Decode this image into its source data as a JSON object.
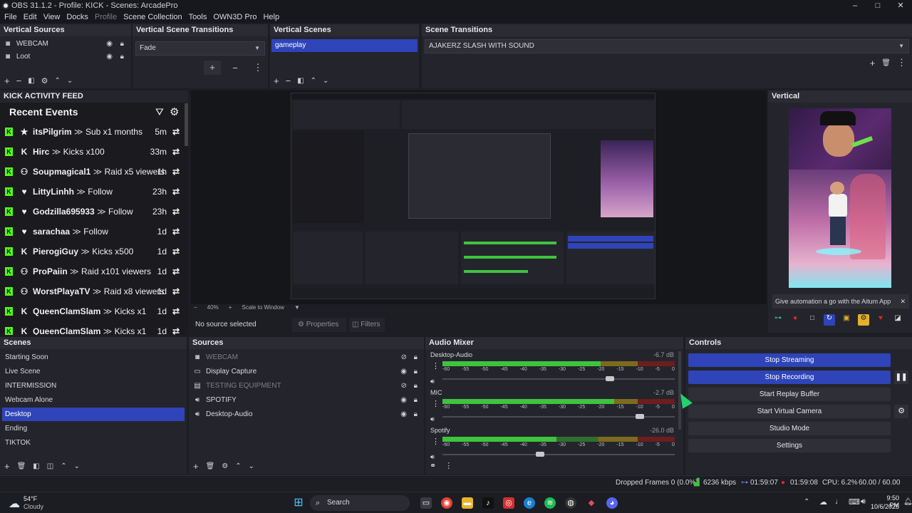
{
  "window": {
    "title": "OBS 31.1.2 - Profile: KICK - Scenes: ArcadePro",
    "minimize": "–",
    "maximize": "□",
    "close": "✕"
  },
  "menu": [
    "File",
    "Edit",
    "View",
    "Docks",
    "Profile",
    "Scene Collection",
    "Tools",
    "OWN3D Pro",
    "Help"
  ],
  "vertical_sources": {
    "title": "Vertical Sources",
    "items": [
      "WEBCAM",
      "Loot"
    ]
  },
  "vertical_scene_transitions": {
    "title": "Vertical Scene Transitions",
    "selected": "Fade"
  },
  "vertical_scenes": {
    "title": "Vertical Scenes",
    "items": [
      "gameplay"
    ]
  },
  "scene_transitions": {
    "title": "Scene Transitions",
    "selected": "AJAKERZ SLASH WITH SOUND"
  },
  "kick_feed": {
    "title": "KICK ACTIVITY FEED",
    "heading": "Recent Events",
    "events": [
      {
        "icon": "★",
        "user": "itsPilgrim",
        "action": "Sub x1 months",
        "time": "5m"
      },
      {
        "icon": "K",
        "user": "Hirc",
        "action": "Kicks x100",
        "time": "33m"
      },
      {
        "icon": "⚇",
        "user": "Soupmagical1",
        "action": "Raid x5 viewers",
        "time": "1h"
      },
      {
        "icon": "♥",
        "user": "LittyLinhh",
        "action": "Follow",
        "time": "23h"
      },
      {
        "icon": "♥",
        "user": "Godzilla695933",
        "action": "Follow",
        "time": "23h"
      },
      {
        "icon": "♥",
        "user": "sarachaa",
        "action": "Follow",
        "time": "1d"
      },
      {
        "icon": "K",
        "user": "PierogiGuy",
        "action": "Kicks x500",
        "time": "1d"
      },
      {
        "icon": "⚇",
        "user": "ProPaiin",
        "action": "Raid x101 viewers",
        "time": "1d"
      },
      {
        "icon": "⚇",
        "user": "WorstPlayaTV",
        "action": "Raid x8 viewers",
        "time": "1d"
      },
      {
        "icon": "K",
        "user": "QueenClamSlam",
        "action": "Kicks x1",
        "time": "1d"
      },
      {
        "icon": "K",
        "user": "QueenClamSlam",
        "action": "Kicks x1",
        "time": "1d"
      }
    ]
  },
  "preview": {
    "zoom": "40%",
    "scale_mode": "Scale to Window"
  },
  "source_bar": {
    "status": "No source selected",
    "properties": "Properties",
    "filters": "Filters"
  },
  "vertical": {
    "title": "Vertical",
    "banner": "Give automation a go with the Aitum App"
  },
  "scenes": {
    "title": "Scenes",
    "items": [
      "Starting Soon",
      "Live Scene",
      "INTERMISSION",
      "Webcam Alone",
      "Desktop",
      "Ending",
      "TIKTOK"
    ],
    "selected_index": 4
  },
  "sources": {
    "title": "Sources",
    "items": [
      {
        "name": "WEBCAM",
        "hidden": true,
        "icon": "camera-icon"
      },
      {
        "name": "Display Capture",
        "hidden": false,
        "icon": "monitor-icon"
      },
      {
        "name": "TESTING EQUIPMENT",
        "hidden": true,
        "icon": "folder-icon"
      },
      {
        "name": "SPOTIFY",
        "hidden": false,
        "icon": "speaker-icon"
      },
      {
        "name": "Desktop-Audio",
        "hidden": false,
        "icon": "speaker-icon"
      }
    ]
  },
  "audio_mixer": {
    "title": "Audio Mixer",
    "scale": [
      "-60",
      "-55",
      "-50",
      "-45",
      "-40",
      "-35",
      "-30",
      "-25",
      "-20",
      "-15",
      "-10",
      "-5",
      "0"
    ],
    "channels": [
      {
        "name": "Desktop-Audio",
        "db": "-6.7 dB",
        "level": 0.68,
        "volume": 0.72
      },
      {
        "name": "MIC",
        "db": "-2.7 dB",
        "level": 0.74,
        "volume": 0.85
      },
      {
        "name": "Spotify",
        "db": "-26.0 dB",
        "level": 0.49,
        "volume": 0.42
      }
    ]
  },
  "controls": {
    "title": "Controls",
    "buttons": [
      "Stop Streaming",
      "Stop Recording",
      "Start Replay Buffer",
      "Start Virtual Camera",
      "Studio Mode",
      "Settings"
    ]
  },
  "status": {
    "dropped": "Dropped Frames 0 (0.0%)",
    "kbps": "6236 kbps",
    "stream_time": "01:59:07",
    "rec_time": "01:59:08",
    "cpu": "CPU: 6.2%",
    "fps": "60.00 / 60.00 FPS"
  },
  "taskbar": {
    "temp": "54°F",
    "weather": "Cloudy",
    "search": "Search",
    "time": "9:50 PM",
    "date": "10/6/2025"
  },
  "colors": {
    "accent": "#2e44b8",
    "kick_green": "#53fc18",
    "rec_red": "#e0262a"
  }
}
